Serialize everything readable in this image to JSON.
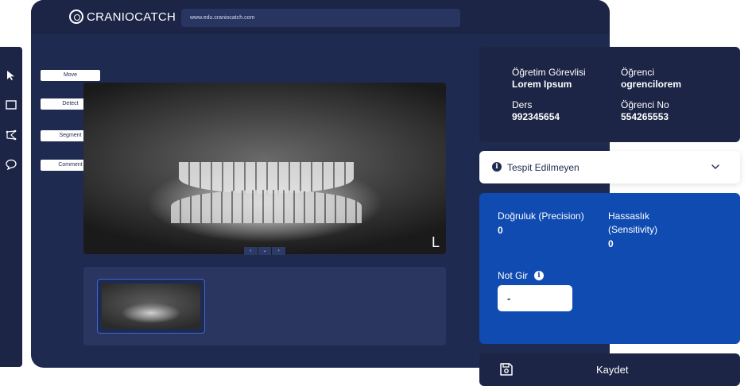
{
  "header": {
    "brand": "CRANIOCATCH",
    "url": "www.edu.craniocatch.com"
  },
  "toolbar": {
    "icons": [
      "cursor-icon",
      "rectangle-icon",
      "polygon-icon",
      "comment-icon"
    ]
  },
  "tools": {
    "move": "Move",
    "detect": "Detect",
    "segment": "Segment",
    "comment": "Comment"
  },
  "viewer": {
    "orientation_marker": "L",
    "nav": {
      "prev": "‹",
      "down": "⌄",
      "next": "›"
    }
  },
  "info": {
    "instructor_label": "Öğretim Görevlisi",
    "instructor_value": "Lorem Ipsum",
    "student_label": "Öğrenci",
    "student_value": "ogrencilorem",
    "course_label": "Ders",
    "course_value": "992345654",
    "student_no_label": "Öğrenci No",
    "student_no_value": "554265553"
  },
  "dropdown": {
    "selected": "Tespit Edilmeyen"
  },
  "metrics": {
    "precision_label": "Doğruluk (Precision)",
    "precision_value": "0",
    "sensitivity_label": "Hassaslık (Sensitivity)",
    "sensitivity_value": "0",
    "note_label": "Not Gir",
    "note_value": "-"
  },
  "save": {
    "label": "Kaydet"
  },
  "colors": {
    "primary_navy": "#1f2a50",
    "header_navy": "#1c2546",
    "accent_blue": "#0f4bb0",
    "thumb_border": "#3d68d8"
  }
}
